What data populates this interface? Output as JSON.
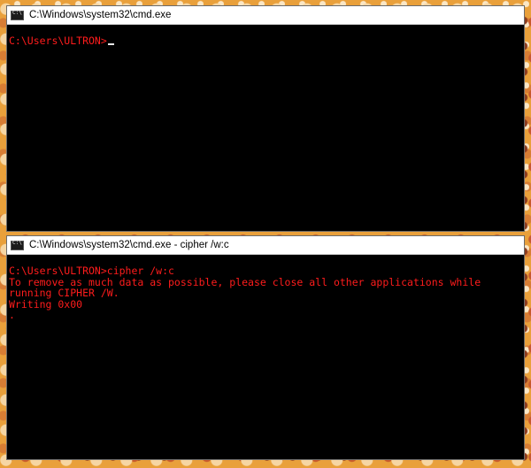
{
  "windows": [
    {
      "title": "C:\\Windows\\system32\\cmd.exe",
      "prompt": "C:\\Users\\ULTRON>",
      "lines": []
    },
    {
      "title": "C:\\Windows\\system32\\cmd.exe - cipher  /w:c",
      "lines": [
        "C:\\Users\\ULTRON>cipher /w:c",
        "To remove as much data as possible, please close all other applications while",
        "running CIPHER /W.",
        "Writing 0x00",
        "."
      ]
    }
  ],
  "colors": {
    "console_text": "#ff1c1c",
    "console_bg": "#000000",
    "titlebar_bg": "#ffffff"
  },
  "icons": {
    "window_icon": "cmd-console-icon"
  }
}
